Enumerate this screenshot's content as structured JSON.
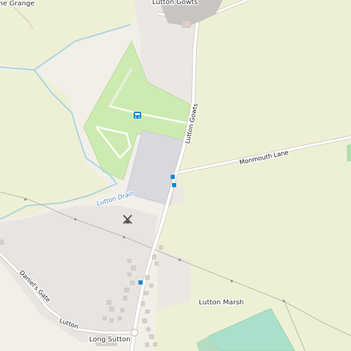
{
  "map": {
    "labels": {
      "grange": "he Grange",
      "lutton_gowts_place": "Lutton Gowts",
      "lutton_gowts_road": "Lutton Gowts",
      "monmouth_lane": "Monmouth Lane",
      "lutton_drain": "Lutton Drain",
      "lutton_marsh": "Lutton Marsh",
      "daniels_gate": "Daniel's Gate",
      "lutton": "Lutton",
      "long_sutton": "Long Sutton"
    },
    "colors": {
      "farmland": "#eef0d5",
      "residential": "#e0dfdf",
      "grass": "#cdebb0",
      "parking": "#dddde8",
      "water": "#aad3df",
      "road_white": "#ffffff",
      "road_casing": "#c8c2b8",
      "bus_stop": "#0a88d6",
      "pitch": "#aae0cb",
      "building": "#d9d0c9"
    },
    "icons": [
      "windmill-icon",
      "bus-station-icon",
      "bus-stop-icon"
    ]
  }
}
